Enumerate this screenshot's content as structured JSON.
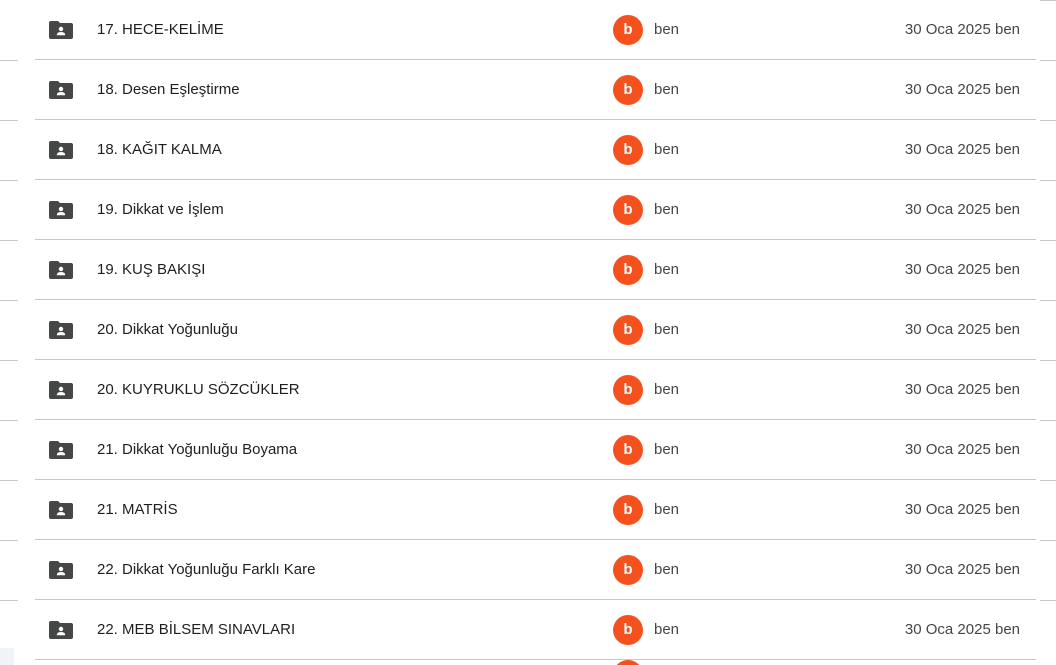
{
  "colors": {
    "avatar": "#f4511e",
    "folder_icon": "#444746",
    "divider": "#c7c7c7"
  },
  "icons": {
    "folder": "shared-folder-icon"
  },
  "rows": [
    {
      "name": "17. HECE-KELİME",
      "avatar_letter": "b",
      "owner": "ben",
      "modified": "30 Oca 2025 ben"
    },
    {
      "name": "18. Desen Eşleştirme",
      "avatar_letter": "b",
      "owner": "ben",
      "modified": "30 Oca 2025 ben"
    },
    {
      "name": "18. KAĞIT KALMA",
      "avatar_letter": "b",
      "owner": "ben",
      "modified": "30 Oca 2025 ben"
    },
    {
      "name": "19. Dikkat ve İşlem",
      "avatar_letter": "b",
      "owner": "ben",
      "modified": "30 Oca 2025 ben"
    },
    {
      "name": "19. KUŞ BAKIŞI",
      "avatar_letter": "b",
      "owner": "ben",
      "modified": "30 Oca 2025 ben"
    },
    {
      "name": "20. Dikkat Yoğunluğu",
      "avatar_letter": "b",
      "owner": "ben",
      "modified": "30 Oca 2025 ben"
    },
    {
      "name": "20. KUYRUKLU SÖZCÜKLER",
      "avatar_letter": "b",
      "owner": "ben",
      "modified": "30 Oca 2025 ben"
    },
    {
      "name": "21. Dikkat Yoğunluğu Boyama",
      "avatar_letter": "b",
      "owner": "ben",
      "modified": "30 Oca 2025 ben"
    },
    {
      "name": "21. MATRİS",
      "avatar_letter": "b",
      "owner": "ben",
      "modified": "30 Oca 2025 ben"
    },
    {
      "name": "22. Dikkat Yoğunluğu Farklı Kare",
      "avatar_letter": "b",
      "owner": "ben",
      "modified": "30 Oca 2025 ben"
    },
    {
      "name": "22. MEB BİLSEM SINAVLARI",
      "avatar_letter": "b",
      "owner": "ben",
      "modified": "30 Oca 2025 ben"
    }
  ]
}
